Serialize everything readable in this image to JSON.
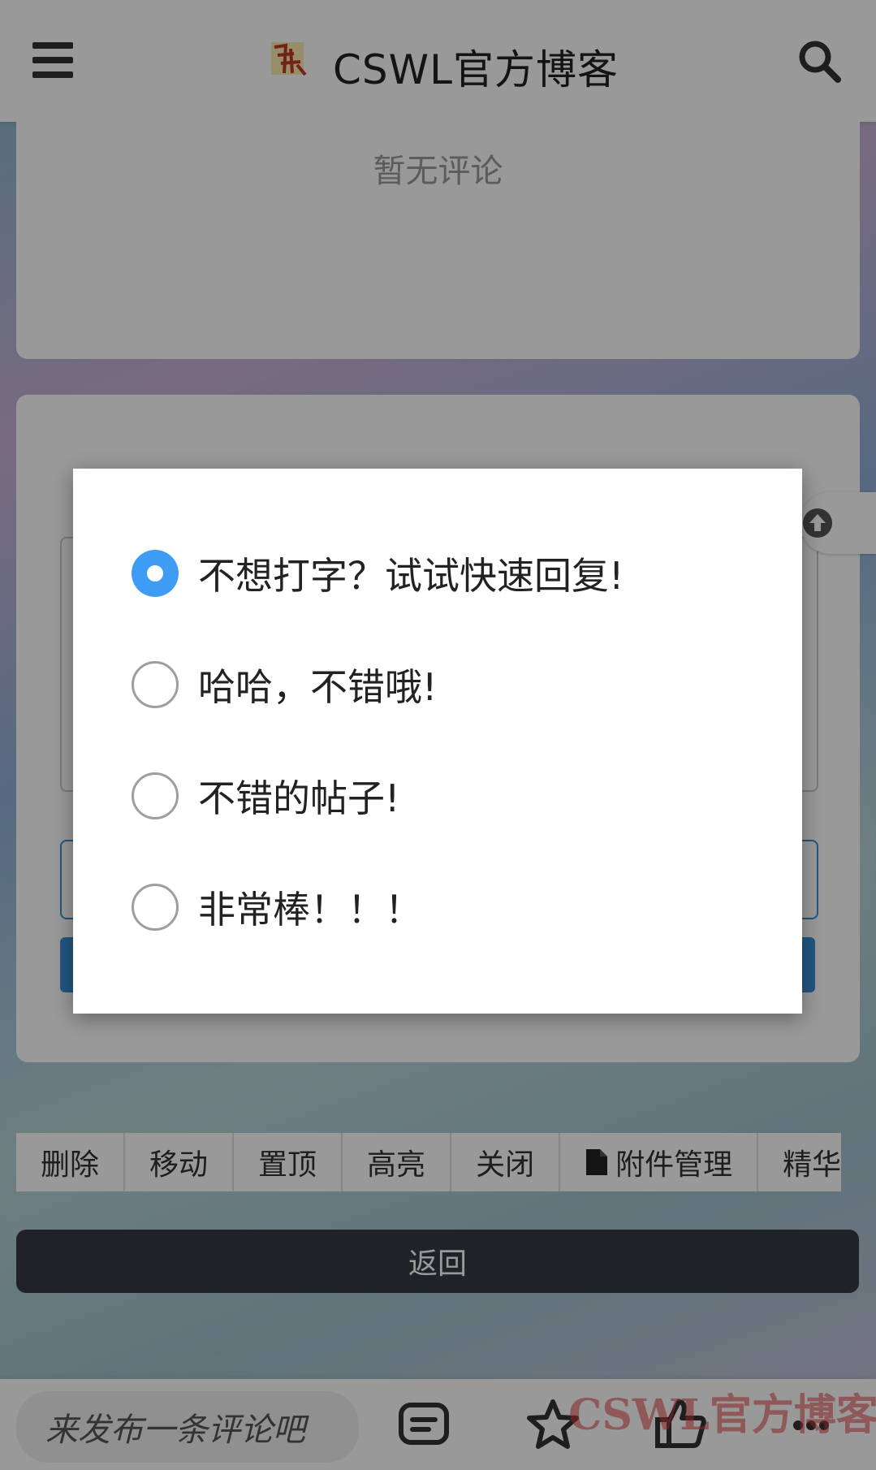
{
  "header": {
    "title": "CSWL官方博客",
    "menu_icon": "hamburger-menu-icon",
    "search_icon": "search-icon"
  },
  "comments": {
    "empty_text": "暂无评论"
  },
  "admin_toolbar": {
    "buttons": [
      "删除",
      "移动",
      "置顶",
      "高亮",
      "关闭",
      "附件管理",
      "精华"
    ],
    "attachment_icon": "file-icon"
  },
  "back_button": {
    "label": "返回"
  },
  "bottom_bar": {
    "comment_placeholder": "来发布一条评论吧",
    "icons": [
      "comment-icon",
      "star-icon",
      "thumbs-up-icon",
      "more-icon"
    ]
  },
  "watermark": {
    "text": "CSWL官方博客"
  },
  "quick_reply_dialog": {
    "selected_index": 0,
    "options": [
      "不想打字？试试快速回复!",
      "哈哈，不错哦!",
      "不错的帖子!",
      "非常棒！！！"
    ]
  },
  "colors": {
    "accent": "#3f9cf4",
    "back_button_bg": "#343a40",
    "editor_blue": "#3a8fd6"
  }
}
